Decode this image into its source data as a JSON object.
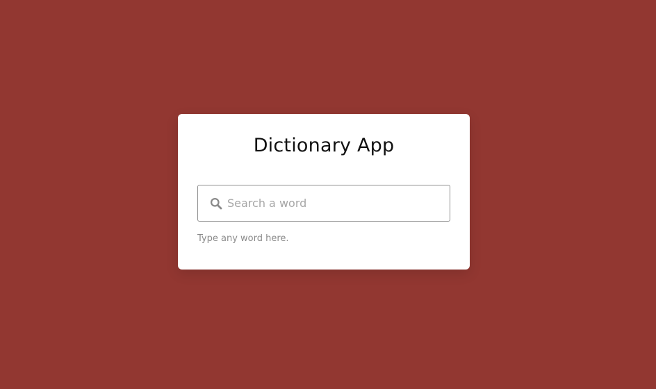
{
  "app": {
    "title": "Dictionary App"
  },
  "search": {
    "value": "",
    "placeholder": "Search a word",
    "icon": "search-icon",
    "hint": "Type any word here."
  },
  "colors": {
    "background": "#923731",
    "card": "#ffffff",
    "title_text": "#111111",
    "hint_text": "#8a8a8a",
    "border": "#8e8e8e"
  }
}
